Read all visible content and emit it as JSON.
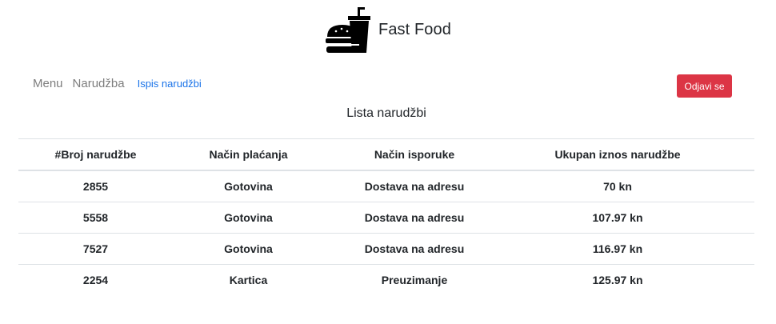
{
  "header": {
    "brand_title": "Fast Food",
    "logo_icon": "burger-and-drink-icon"
  },
  "nav": {
    "items": [
      {
        "label": "Menu"
      },
      {
        "label": "Narudžba"
      },
      {
        "label": "Ispis narudžbi",
        "active": true
      }
    ],
    "logout_label": "Odjavi se"
  },
  "colors": {
    "accent_link": "#1a73e8",
    "danger": "#dc3545",
    "nav_muted": "#7d7d7d"
  },
  "page_title": "Lista narudžbi",
  "table": {
    "headers": [
      "#Broj narudžbe",
      "Način plaćanja",
      "Način isporuke",
      "Ukupan iznos narudžbe"
    ],
    "rows": [
      [
        "2855",
        "Gotovina",
        "Dostava na adresu",
        "70 kn"
      ],
      [
        "5558",
        "Gotovina",
        "Dostava na adresu",
        "107.97 kn"
      ],
      [
        "7527",
        "Gotovina",
        "Dostava na adresu",
        "116.97 kn"
      ],
      [
        "2254",
        "Kartica",
        "Preuzimanje",
        "125.97 kn"
      ]
    ]
  }
}
